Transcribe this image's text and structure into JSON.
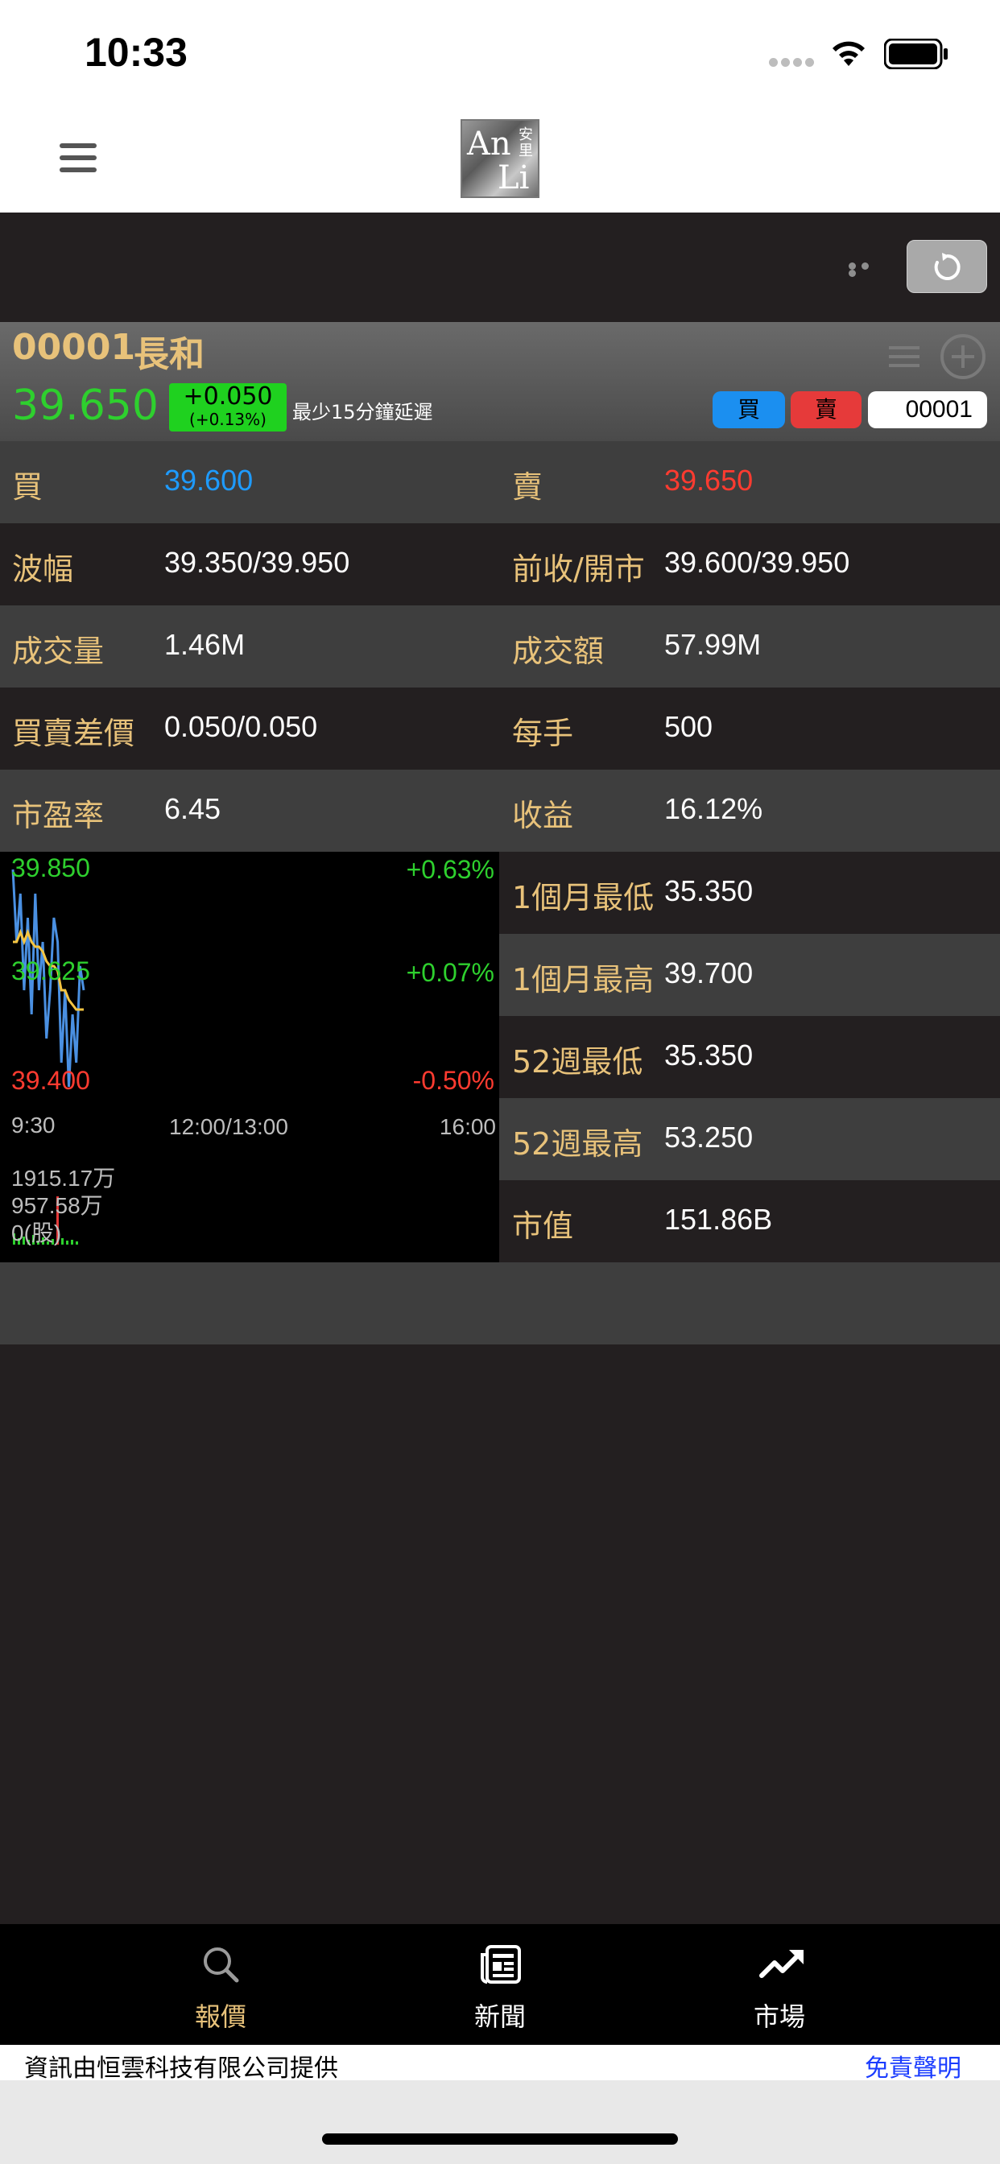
{
  "status_bar": {
    "time": "10:33"
  },
  "header": {
    "logo_text_1": "An",
    "logo_text_2": "Li",
    "logo_text_3": "安里"
  },
  "stock": {
    "code": "00001",
    "name": "長和",
    "price": "39.650",
    "change": "+0.050",
    "change_pct": "(+0.13%)",
    "delay_note": "最少15分鐘延遲",
    "buy_label": "買",
    "sell_label": "賣",
    "code_input_value": "00001"
  },
  "quote_rows": [
    {
      "l_label": "買",
      "l_value": "39.600",
      "r_label": "賣",
      "r_value": "39.650"
    },
    {
      "l_label": "波幅",
      "l_value": "39.350/39.950",
      "r_label": "前收/開市",
      "r_value": "39.600/39.950"
    },
    {
      "l_label": "成交量",
      "l_value": "1.46M",
      "r_label": "成交額",
      "r_value": "57.99M"
    },
    {
      "l_label": "買賣差價",
      "l_value": "0.050/0.050",
      "r_label": "每手",
      "r_value": "500"
    },
    {
      "l_label": "市盈率",
      "l_value": "6.45",
      "r_label": "收益",
      "r_value": "16.12%"
    }
  ],
  "right_rows": [
    {
      "label": "1個月最低",
      "value": "35.350"
    },
    {
      "label": "1個月最高",
      "value": "39.700"
    },
    {
      "label": "52週最低",
      "value": "35.350"
    },
    {
      "label": "52週最高",
      "value": "53.250"
    },
    {
      "label": "市值",
      "value": "151.86B"
    }
  ],
  "chart_data": {
    "type": "line",
    "y_left_labels": [
      "39.850",
      "39.625",
      "39.400"
    ],
    "y_right_labels": [
      "+0.63%",
      "+0.07%",
      "-0.50%"
    ],
    "x_labels": [
      "9:30",
      "12:00/13:00",
      "16:00"
    ],
    "volume_labels": [
      "1915.17万",
      "957.58万",
      "0(股)"
    ],
    "ylim": [
      39.4,
      39.85
    ],
    "series": [
      {
        "values": [
          39.85,
          39.7,
          39.8,
          39.6,
          39.75,
          39.55,
          39.8,
          39.6,
          39.7,
          39.5,
          39.6,
          39.75,
          39.7,
          39.45,
          39.6,
          39.4,
          39.55,
          39.45,
          39.65,
          39.6
        ]
      },
      {
        "values": [
          39.7,
          39.7,
          39.72,
          39.7,
          39.72,
          39.7,
          39.69,
          39.69,
          39.68,
          39.66,
          39.65,
          39.65,
          39.64,
          39.6,
          39.6,
          39.58,
          39.57,
          39.56,
          39.56,
          39.56
        ]
      }
    ],
    "colors": {
      "price_line": "#4a90e2",
      "avg_line": "#f5c542"
    }
  },
  "tabs": [
    {
      "label": "報價",
      "icon": "search-icon",
      "color": "#e8c27a"
    },
    {
      "label": "新聞",
      "icon": "news-icon",
      "color": "#ffffff"
    },
    {
      "label": "市場",
      "icon": "trend-icon",
      "color": "#ffffff"
    }
  ],
  "footer": {
    "source": "資訊由恒雲科技有限公司提供",
    "disclaimer": "免責聲明"
  }
}
